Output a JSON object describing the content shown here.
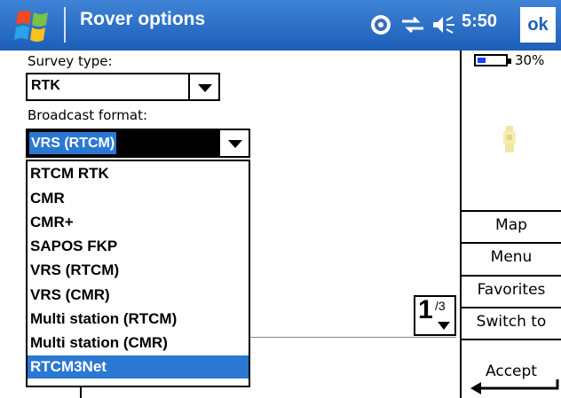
{
  "titlebar": {
    "title": "Rover options",
    "time": "5:50",
    "ok_label": "ok",
    "icons": [
      "windows-start-icon",
      "satellite-icon",
      "connectivity-icon",
      "volume-icon"
    ]
  },
  "form": {
    "survey_type_label": "Survey type:",
    "survey_type_value": "RTK",
    "broadcast_format_label": "Broadcast format:",
    "broadcast_format_value": "VRS (RTCM)"
  },
  "dropdown": {
    "items": [
      "RTCM RTK",
      "CMR",
      "CMR+",
      "SAPOS FKP",
      "VRS (RTCM)",
      "VRS (CMR)",
      "Multi station (RTCM)",
      "Multi station (CMR)",
      "RTCM3Net"
    ],
    "selected": "RTCM3Net"
  },
  "pager": {
    "current": "1",
    "total": "/3"
  },
  "sidebar": {
    "battery_percent": "30%",
    "battery_level": 0.3,
    "buttons": {
      "map": "Map",
      "menu": "Menu",
      "favorites": "Favorites",
      "switch_to": "Switch to"
    },
    "accept_label": "Accept"
  },
  "colors": {
    "titlebar": "#1d5fb8",
    "selection": "#2b78d2",
    "battery_fill": "#1a3cff"
  }
}
